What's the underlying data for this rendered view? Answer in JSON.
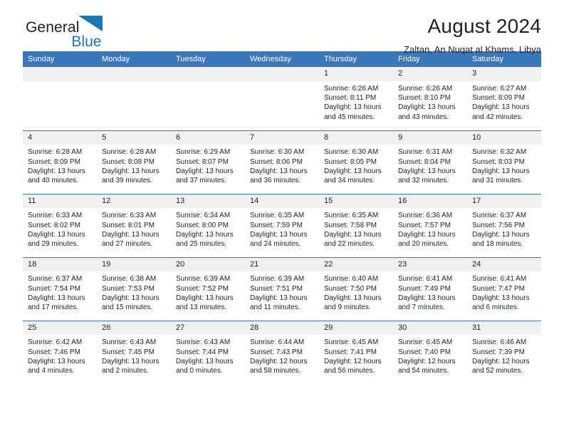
{
  "brand": {
    "name_dark": "General",
    "name_blue": "Blue",
    "triangle_color": "#1b75bb",
    "text_color": "#231f20"
  },
  "header": {
    "title": "August 2024",
    "subtitle": "Zaltan, An Nuqat al Khams, Libya"
  },
  "theme": {
    "header_bg": "#3a77b8",
    "header_text": "#ffffff",
    "daynum_bg": "#f0f0f0",
    "cell_bg": "#ffffff",
    "grid_line": "#3a77b8"
  },
  "weekdays": [
    "Sunday",
    "Monday",
    "Tuesday",
    "Wednesday",
    "Thursday",
    "Friday",
    "Saturday"
  ],
  "weeks": [
    [
      {
        "day": "",
        "lines": []
      },
      {
        "day": "",
        "lines": []
      },
      {
        "day": "",
        "lines": []
      },
      {
        "day": "",
        "lines": []
      },
      {
        "day": "1",
        "lines": [
          "Sunrise: 6:26 AM",
          "Sunset: 8:11 PM",
          "Daylight: 13 hours",
          "and 45 minutes."
        ]
      },
      {
        "day": "2",
        "lines": [
          "Sunrise: 6:26 AM",
          "Sunset: 8:10 PM",
          "Daylight: 13 hours",
          "and 43 minutes."
        ]
      },
      {
        "day": "3",
        "lines": [
          "Sunrise: 6:27 AM",
          "Sunset: 8:09 PM",
          "Daylight: 13 hours",
          "and 42 minutes."
        ]
      }
    ],
    [
      {
        "day": "4",
        "lines": [
          "Sunrise: 6:28 AM",
          "Sunset: 8:09 PM",
          "Daylight: 13 hours",
          "and 40 minutes."
        ]
      },
      {
        "day": "5",
        "lines": [
          "Sunrise: 6:28 AM",
          "Sunset: 8:08 PM",
          "Daylight: 13 hours",
          "and 39 minutes."
        ]
      },
      {
        "day": "6",
        "lines": [
          "Sunrise: 6:29 AM",
          "Sunset: 8:07 PM",
          "Daylight: 13 hours",
          "and 37 minutes."
        ]
      },
      {
        "day": "7",
        "lines": [
          "Sunrise: 6:30 AM",
          "Sunset: 8:06 PM",
          "Daylight: 13 hours",
          "and 36 minutes."
        ]
      },
      {
        "day": "8",
        "lines": [
          "Sunrise: 6:30 AM",
          "Sunset: 8:05 PM",
          "Daylight: 13 hours",
          "and 34 minutes."
        ]
      },
      {
        "day": "9",
        "lines": [
          "Sunrise: 6:31 AM",
          "Sunset: 8:04 PM",
          "Daylight: 13 hours",
          "and 32 minutes."
        ]
      },
      {
        "day": "10",
        "lines": [
          "Sunrise: 6:32 AM",
          "Sunset: 8:03 PM",
          "Daylight: 13 hours",
          "and 31 minutes."
        ]
      }
    ],
    [
      {
        "day": "11",
        "lines": [
          "Sunrise: 6:33 AM",
          "Sunset: 8:02 PM",
          "Daylight: 13 hours",
          "and 29 minutes."
        ]
      },
      {
        "day": "12",
        "lines": [
          "Sunrise: 6:33 AM",
          "Sunset: 8:01 PM",
          "Daylight: 13 hours",
          "and 27 minutes."
        ]
      },
      {
        "day": "13",
        "lines": [
          "Sunrise: 6:34 AM",
          "Sunset: 8:00 PM",
          "Daylight: 13 hours",
          "and 25 minutes."
        ]
      },
      {
        "day": "14",
        "lines": [
          "Sunrise: 6:35 AM",
          "Sunset: 7:59 PM",
          "Daylight: 13 hours",
          "and 24 minutes."
        ]
      },
      {
        "day": "15",
        "lines": [
          "Sunrise: 6:35 AM",
          "Sunset: 7:58 PM",
          "Daylight: 13 hours",
          "and 22 minutes."
        ]
      },
      {
        "day": "16",
        "lines": [
          "Sunrise: 6:36 AM",
          "Sunset: 7:57 PM",
          "Daylight: 13 hours",
          "and 20 minutes."
        ]
      },
      {
        "day": "17",
        "lines": [
          "Sunrise: 6:37 AM",
          "Sunset: 7:56 PM",
          "Daylight: 13 hours",
          "and 18 minutes."
        ]
      }
    ],
    [
      {
        "day": "18",
        "lines": [
          "Sunrise: 6:37 AM",
          "Sunset: 7:54 PM",
          "Daylight: 13 hours",
          "and 17 minutes."
        ]
      },
      {
        "day": "19",
        "lines": [
          "Sunrise: 6:38 AM",
          "Sunset: 7:53 PM",
          "Daylight: 13 hours",
          "and 15 minutes."
        ]
      },
      {
        "day": "20",
        "lines": [
          "Sunrise: 6:39 AM",
          "Sunset: 7:52 PM",
          "Daylight: 13 hours",
          "and 13 minutes."
        ]
      },
      {
        "day": "21",
        "lines": [
          "Sunrise: 6:39 AM",
          "Sunset: 7:51 PM",
          "Daylight: 13 hours",
          "and 11 minutes."
        ]
      },
      {
        "day": "22",
        "lines": [
          "Sunrise: 6:40 AM",
          "Sunset: 7:50 PM",
          "Daylight: 13 hours",
          "and 9 minutes."
        ]
      },
      {
        "day": "23",
        "lines": [
          "Sunrise: 6:41 AM",
          "Sunset: 7:49 PM",
          "Daylight: 13 hours",
          "and 7 minutes."
        ]
      },
      {
        "day": "24",
        "lines": [
          "Sunrise: 6:41 AM",
          "Sunset: 7:47 PM",
          "Daylight: 13 hours",
          "and 6 minutes."
        ]
      }
    ],
    [
      {
        "day": "25",
        "lines": [
          "Sunrise: 6:42 AM",
          "Sunset: 7:46 PM",
          "Daylight: 13 hours",
          "and 4 minutes."
        ]
      },
      {
        "day": "26",
        "lines": [
          "Sunrise: 6:43 AM",
          "Sunset: 7:45 PM",
          "Daylight: 13 hours",
          "and 2 minutes."
        ]
      },
      {
        "day": "27",
        "lines": [
          "Sunrise: 6:43 AM",
          "Sunset: 7:44 PM",
          "Daylight: 13 hours",
          "and 0 minutes."
        ]
      },
      {
        "day": "28",
        "lines": [
          "Sunrise: 6:44 AM",
          "Sunset: 7:43 PM",
          "Daylight: 12 hours",
          "and 58 minutes."
        ]
      },
      {
        "day": "29",
        "lines": [
          "Sunrise: 6:45 AM",
          "Sunset: 7:41 PM",
          "Daylight: 12 hours",
          "and 56 minutes."
        ]
      },
      {
        "day": "30",
        "lines": [
          "Sunrise: 6:45 AM",
          "Sunset: 7:40 PM",
          "Daylight: 12 hours",
          "and 54 minutes."
        ]
      },
      {
        "day": "31",
        "lines": [
          "Sunrise: 6:46 AM",
          "Sunset: 7:39 PM",
          "Daylight: 12 hours",
          "and 52 minutes."
        ]
      }
    ]
  ]
}
